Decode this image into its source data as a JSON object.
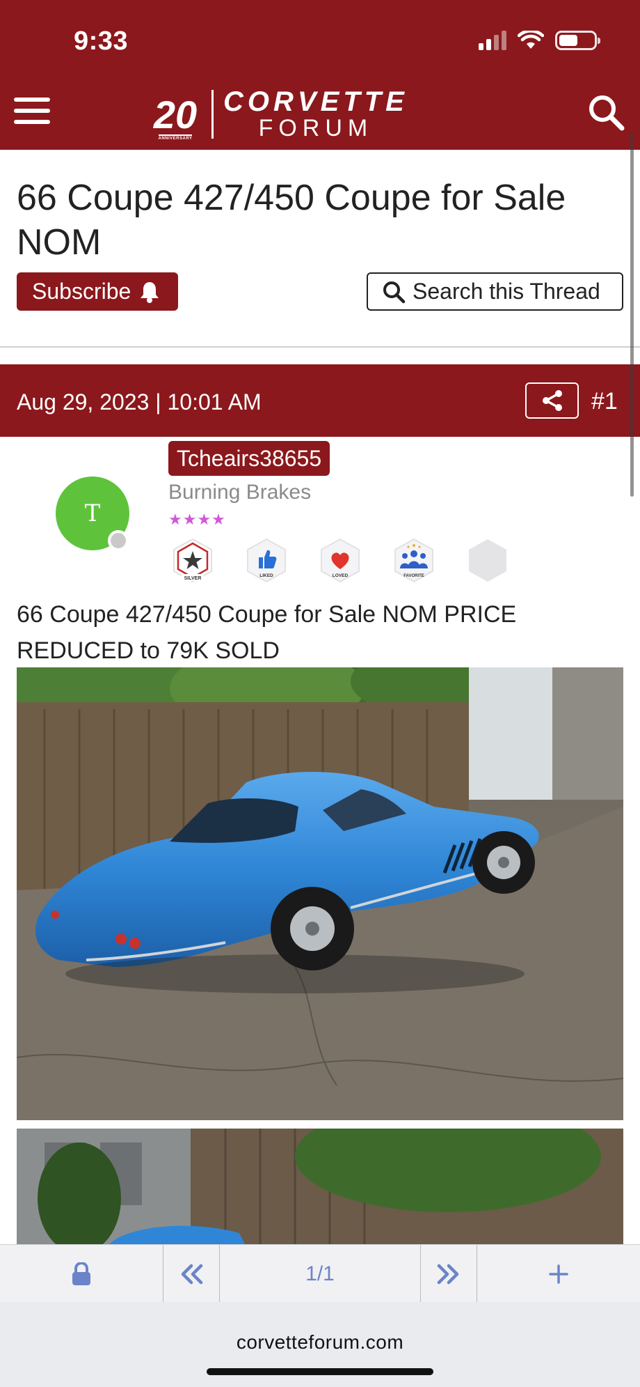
{
  "status_bar": {
    "time": "9:33"
  },
  "header": {
    "logo": {
      "anniversary": "20",
      "anniversary_sub": "ANNIVERSARY",
      "line1": "CORVETTE",
      "line2": "FORUM"
    }
  },
  "thread": {
    "title": "66 Coupe 427/450 Coupe for Sale NOM",
    "subscribe_label": "Subscribe",
    "search_label": "Search this Thread"
  },
  "post": {
    "date": "Aug 29, 2023 | 10:01 AM",
    "number": "#1",
    "avatar_letter": "T",
    "username": "Tcheairs38655",
    "rank": "Burning Brakes",
    "stars": "★★★★",
    "badges": [
      "SILVER",
      "LIKED",
      "LOVED",
      "FAVORITE"
    ],
    "body": "66 Coupe 427/450 Coupe for Sale NOM PRICE REDUCED to 79K SOLD"
  },
  "pager": {
    "page": "1/1"
  },
  "browser": {
    "url": "corvetteforum.com"
  },
  "colors": {
    "brand": "#8b181c",
    "avatar": "#5ec33b",
    "pager_accent": "#6b84c9",
    "car_blue": "#2f86d6"
  },
  "icons": [
    "menu-icon",
    "search-icon",
    "bell-icon",
    "share-icon",
    "lock-icon",
    "double-chevron-left-icon",
    "double-chevron-right-icon",
    "plus-icon"
  ]
}
